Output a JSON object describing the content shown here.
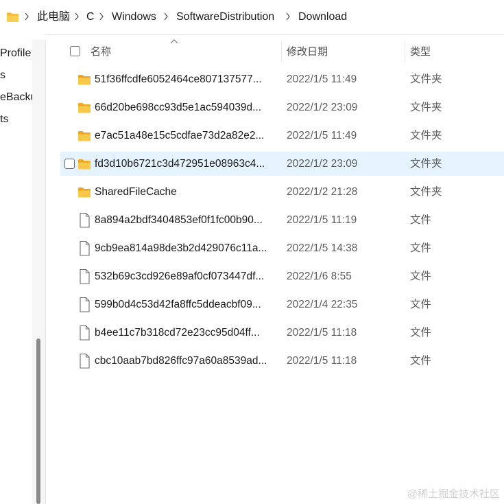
{
  "breadcrumb": {
    "items": [
      "此电脑",
      "C",
      "Windows",
      "SoftwareDistribution",
      "Download"
    ]
  },
  "nav": {
    "items": [
      "Profile",
      "s",
      "eBacku",
      "ts"
    ]
  },
  "columns": {
    "name": "名称",
    "modified": "修改日期",
    "type": "类型"
  },
  "files": [
    {
      "name": "51f36ffcdfe6052464ce807137577...",
      "modified": "2022/1/5 11:49",
      "type": "文件夹",
      "kind": "folder"
    },
    {
      "name": "66d20be698cc93d5e1ac594039d...",
      "modified": "2022/1/2 23:09",
      "type": "文件夹",
      "kind": "folder"
    },
    {
      "name": "e7ac51a48e15c5cdfae73d2a82e2...",
      "modified": "2022/1/5 11:49",
      "type": "文件夹",
      "kind": "folder"
    },
    {
      "name": "fd3d10b6721c3d472951e08963c4...",
      "modified": "2022/1/2 23:09",
      "type": "文件夹",
      "kind": "folder",
      "selected": true
    },
    {
      "name": "SharedFileCache",
      "modified": "2022/1/2 21:28",
      "type": "文件夹",
      "kind": "folder"
    },
    {
      "name": "8a894a2bdf3404853ef0f1fc00b90...",
      "modified": "2022/1/5 11:19",
      "type": "文件",
      "kind": "file"
    },
    {
      "name": "9cb9ea814a98de3b2d429076c11a...",
      "modified": "2022/1/5 14:38",
      "type": "文件",
      "kind": "file"
    },
    {
      "name": "532b69c3cd926e89af0cf073447df...",
      "modified": "2022/1/6 8:55",
      "type": "文件",
      "kind": "file"
    },
    {
      "name": "599b0d4c53d42fa8ffc5ddeacbf09...",
      "modified": "2022/1/4 22:35",
      "type": "文件",
      "kind": "file"
    },
    {
      "name": "b4ee11c7b318cd72e23cc95d04ff...",
      "modified": "2022/1/5 11:18",
      "type": "文件",
      "kind": "file"
    },
    {
      "name": "cbc10aab7bd826ffc97a60a8539ad...",
      "modified": "2022/1/5 11:18",
      "type": "文件",
      "kind": "file"
    }
  ],
  "watermark": "@稀土掘金技术社区",
  "colors": {
    "selected_row": "#e5f3ff",
    "folder": "#f8c84a"
  }
}
